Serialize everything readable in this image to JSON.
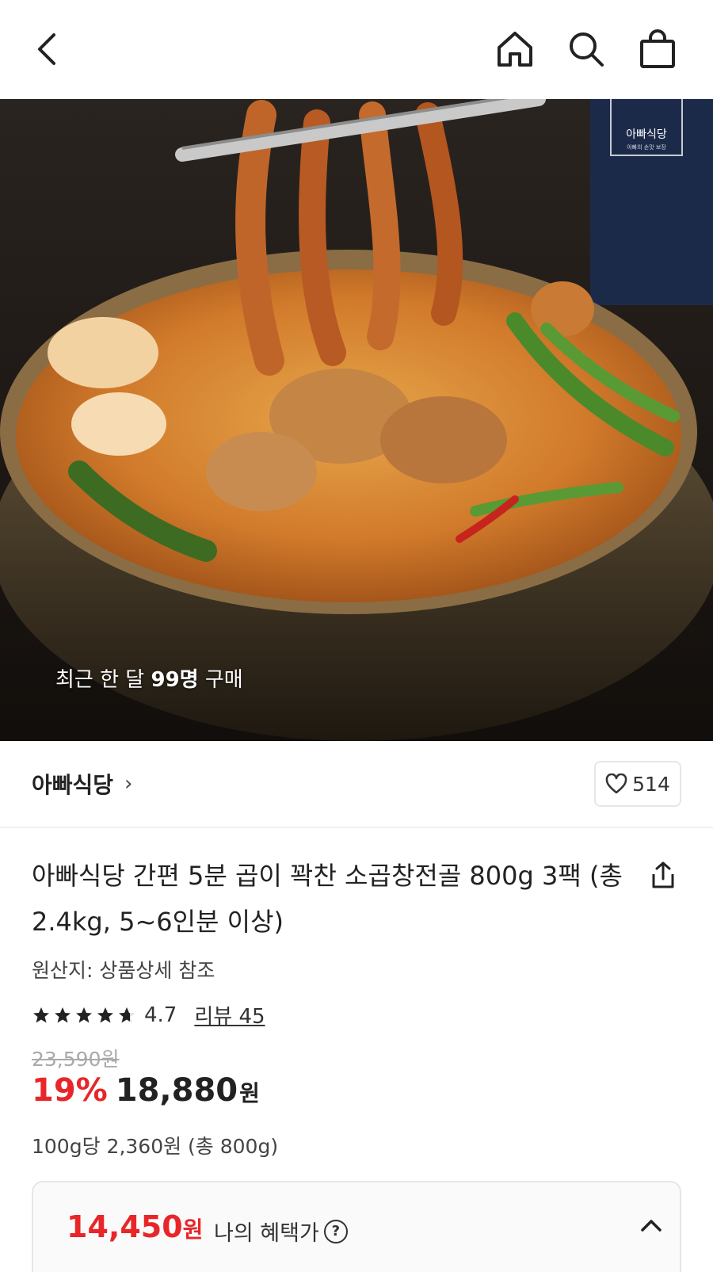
{
  "header": {
    "back_icon": "chevron-left-icon",
    "home_icon": "home-icon",
    "search_icon": "search-icon",
    "cart_icon": "shopping-bag-icon"
  },
  "hero": {
    "buyers_prefix": "최근 한 달 ",
    "buyers_count": "99명",
    "buyers_suffix": " 구매",
    "brand_badge": "아빠식당",
    "brand_badge_sub": "아빠의 손맛 보장"
  },
  "store": {
    "name": "아빠식당",
    "chevron": "›",
    "like_count": "514"
  },
  "product": {
    "title": "아빠식당 간편 5분 곱이 꽉찬 소곱창전골 800g 3팩 (총 2.4kg, 5~6인분 이상)",
    "origin": "원산지: 상품상세 참조",
    "rating": "4.7",
    "review_link": "리뷰 45",
    "original_price": "23,590원",
    "discount": "19%",
    "price": "18,880",
    "price_unit": "원",
    "unit_price": "100g당 2,360원 (총 800g)"
  },
  "benefit": {
    "price": "14,450",
    "price_unit": "원",
    "label": "나의 혜택가",
    "help": "?"
  },
  "colors": {
    "accent_red": "#e8262a",
    "text": "#222222",
    "border": "#e6e6e6"
  }
}
